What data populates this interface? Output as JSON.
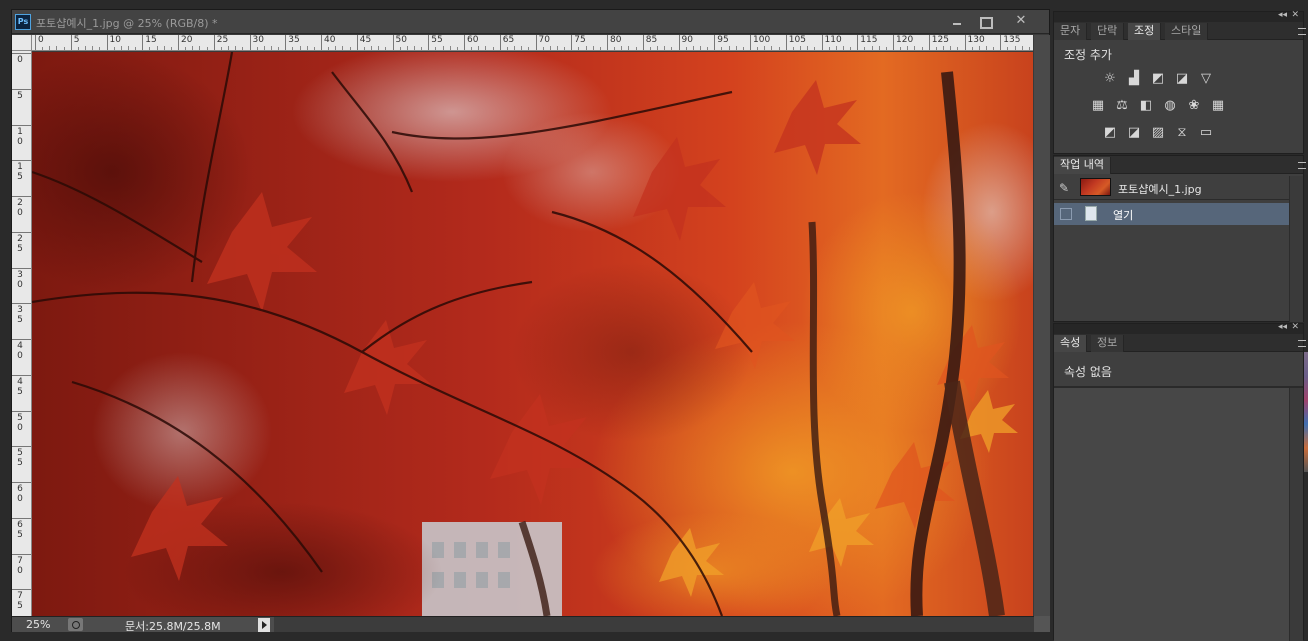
{
  "document": {
    "app_icon_text": "Ps",
    "title": "포토샵예시_1.jpg @ 25% (RGB/8) *",
    "close_glyph": "✕"
  },
  "rulers": {
    "horizontal_labels": [
      "0",
      "5",
      "10",
      "15",
      "20",
      "25",
      "30",
      "35",
      "40",
      "45",
      "50",
      "55",
      "60",
      "65",
      "70",
      "75",
      "80",
      "85",
      "90",
      "95",
      "100",
      "105",
      "110",
      "115",
      "120",
      "125",
      "130",
      "135",
      "1"
    ],
    "vertical_labels": [
      "0",
      "5",
      "10",
      "15",
      "20",
      "25",
      "30",
      "35",
      "40",
      "45",
      "50",
      "55",
      "60",
      "65",
      "70",
      "75"
    ]
  },
  "status": {
    "zoom": "25%",
    "doc_size": "문서:25.8M/25.8M"
  },
  "panels": {
    "top_tabs": [
      "문자",
      "단락",
      "조정",
      "스타일"
    ],
    "top_active_tab": "조정",
    "adjustments_title": "조정 추가",
    "adjustment_icons": [
      [
        "brightness-contrast-icon",
        "levels-icon",
        "curves-icon",
        "exposure-icon",
        "vibrance-icon"
      ],
      [
        "hue-saturation-icon",
        "color-balance-icon",
        "black-white-icon",
        "photo-filter-icon",
        "channel-mixer-icon",
        "color-lookup-icon"
      ],
      [
        "invert-icon",
        "posterize-icon",
        "threshold-icon",
        "selective-color-icon",
        "gradient-map-icon"
      ]
    ],
    "history_tab": "작업 내역",
    "history_snapshot": "포토샵예시_1.jpg",
    "history_items": [
      "열기"
    ],
    "bottom_tabs": [
      "속성",
      "정보"
    ],
    "bottom_active_tab": "속성",
    "properties_text": "속성 없음",
    "collapse_glyph": "◂◂",
    "close_glyph": "✕"
  },
  "colors": {
    "accent_selection": "#56667a",
    "photo_dominant": "#b3311f"
  }
}
